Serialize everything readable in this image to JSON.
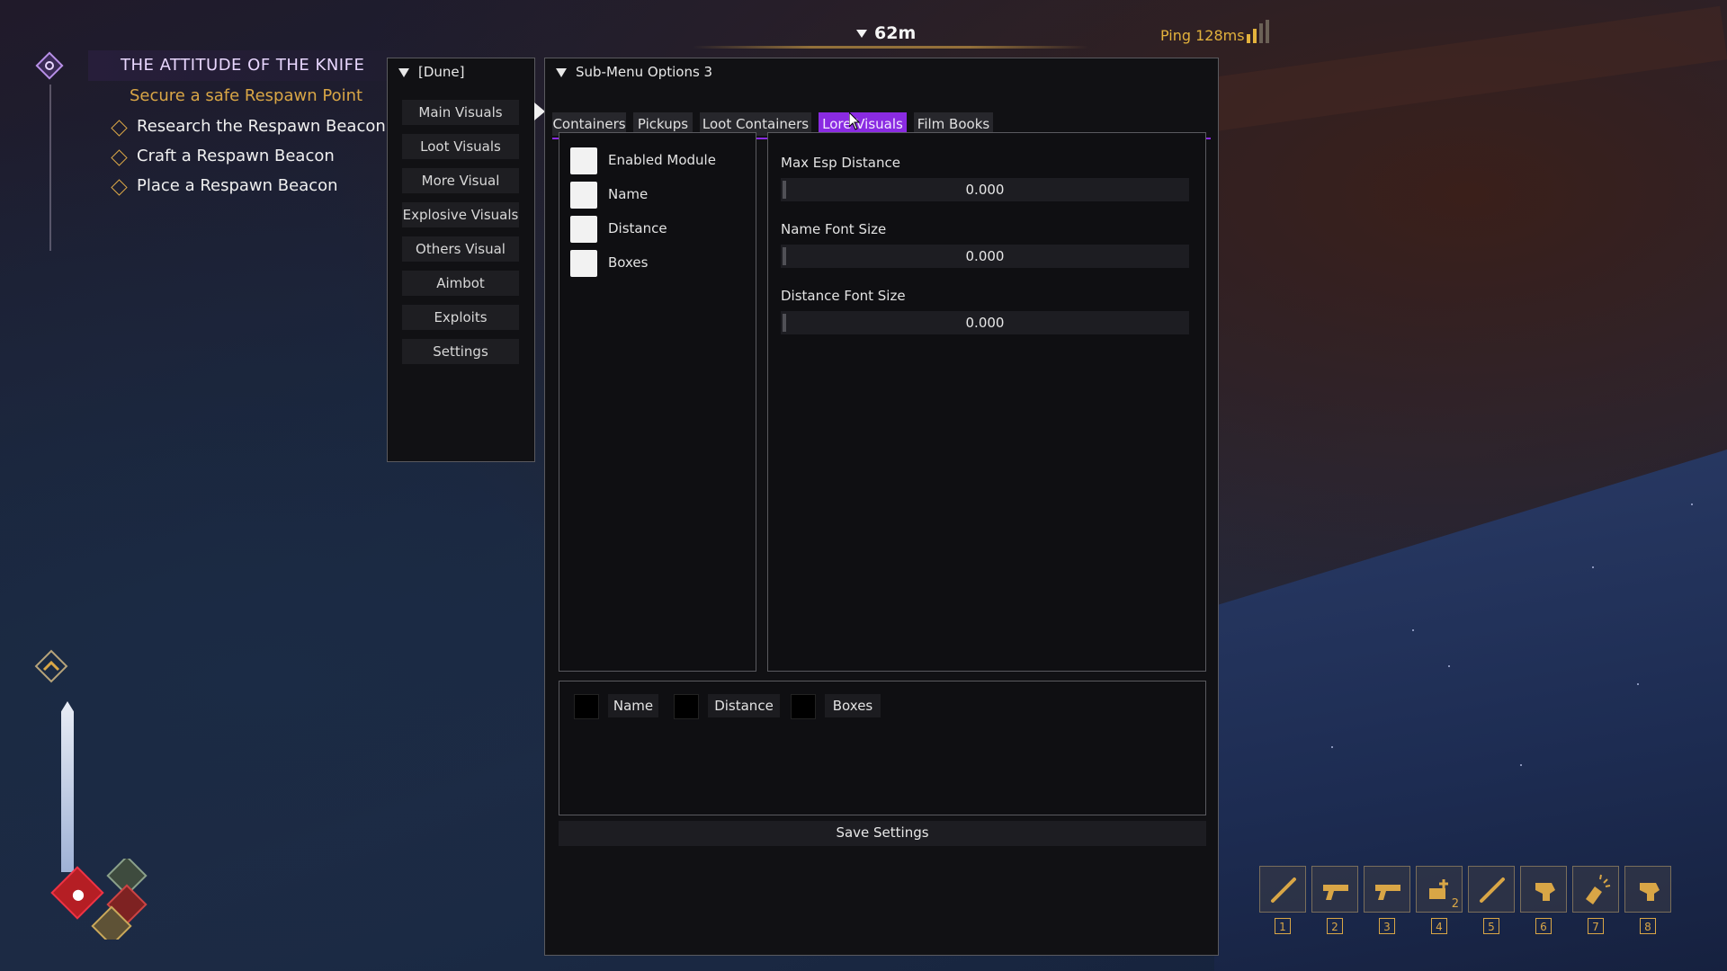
{
  "quest": {
    "title": "THE ATTITUDE OF THE KNIFE",
    "objective": "Secure a safe Respawn Point",
    "steps": [
      "Research the Respawn Beacon",
      "Craft a Respawn Beacon",
      "Place a Respawn Beacon"
    ]
  },
  "hud": {
    "distance": "62m",
    "ping": "Ping 128ms",
    "hotbar": [
      {
        "slot": "1",
        "icon": "knife-icon"
      },
      {
        "slot": "2",
        "icon": "pistol-icon"
      },
      {
        "slot": "3",
        "icon": "pistol-icon"
      },
      {
        "slot": "4",
        "icon": "healkit-icon",
        "count": "2"
      },
      {
        "slot": "5",
        "icon": "knife-icon"
      },
      {
        "slot": "6",
        "icon": "tool-icon"
      },
      {
        "slot": "7",
        "icon": "flashlight-icon"
      },
      {
        "slot": "8",
        "icon": "tool-icon"
      }
    ]
  },
  "main_menu": {
    "title": "[Dune]",
    "items": [
      "Main Visuals",
      "Loot Visuals",
      "More Visual",
      "Explosive Visuals",
      "Others Visual",
      "Aimbot",
      "Exploits",
      "Settings"
    ]
  },
  "sub_menu": {
    "title": "Sub-Menu Options 3",
    "tabs": [
      "Containers",
      "Pickups",
      "Loot Containers",
      "Lore Visuals",
      "Film Books"
    ],
    "active_tab": "Lore Visuals",
    "checkboxes": [
      "Enabled Module",
      "Name",
      "Distance",
      "Boxes"
    ],
    "sliders": [
      {
        "label": "Max Esp Distance",
        "value": "0.000"
      },
      {
        "label": "Name Font Size",
        "value": "0.000"
      },
      {
        "label": "Distance Font Size",
        "value": "0.000"
      }
    ],
    "colors": [
      {
        "label": "Name",
        "color": "#000000"
      },
      {
        "label": "Distance",
        "color": "#000000"
      },
      {
        "label": "Boxes",
        "color": "#000000"
      }
    ],
    "save_label": "Save Settings"
  },
  "colors": {
    "accent": "#8a2be2",
    "quest_gold": "#d9a646",
    "panel_bg": "#111114"
  }
}
